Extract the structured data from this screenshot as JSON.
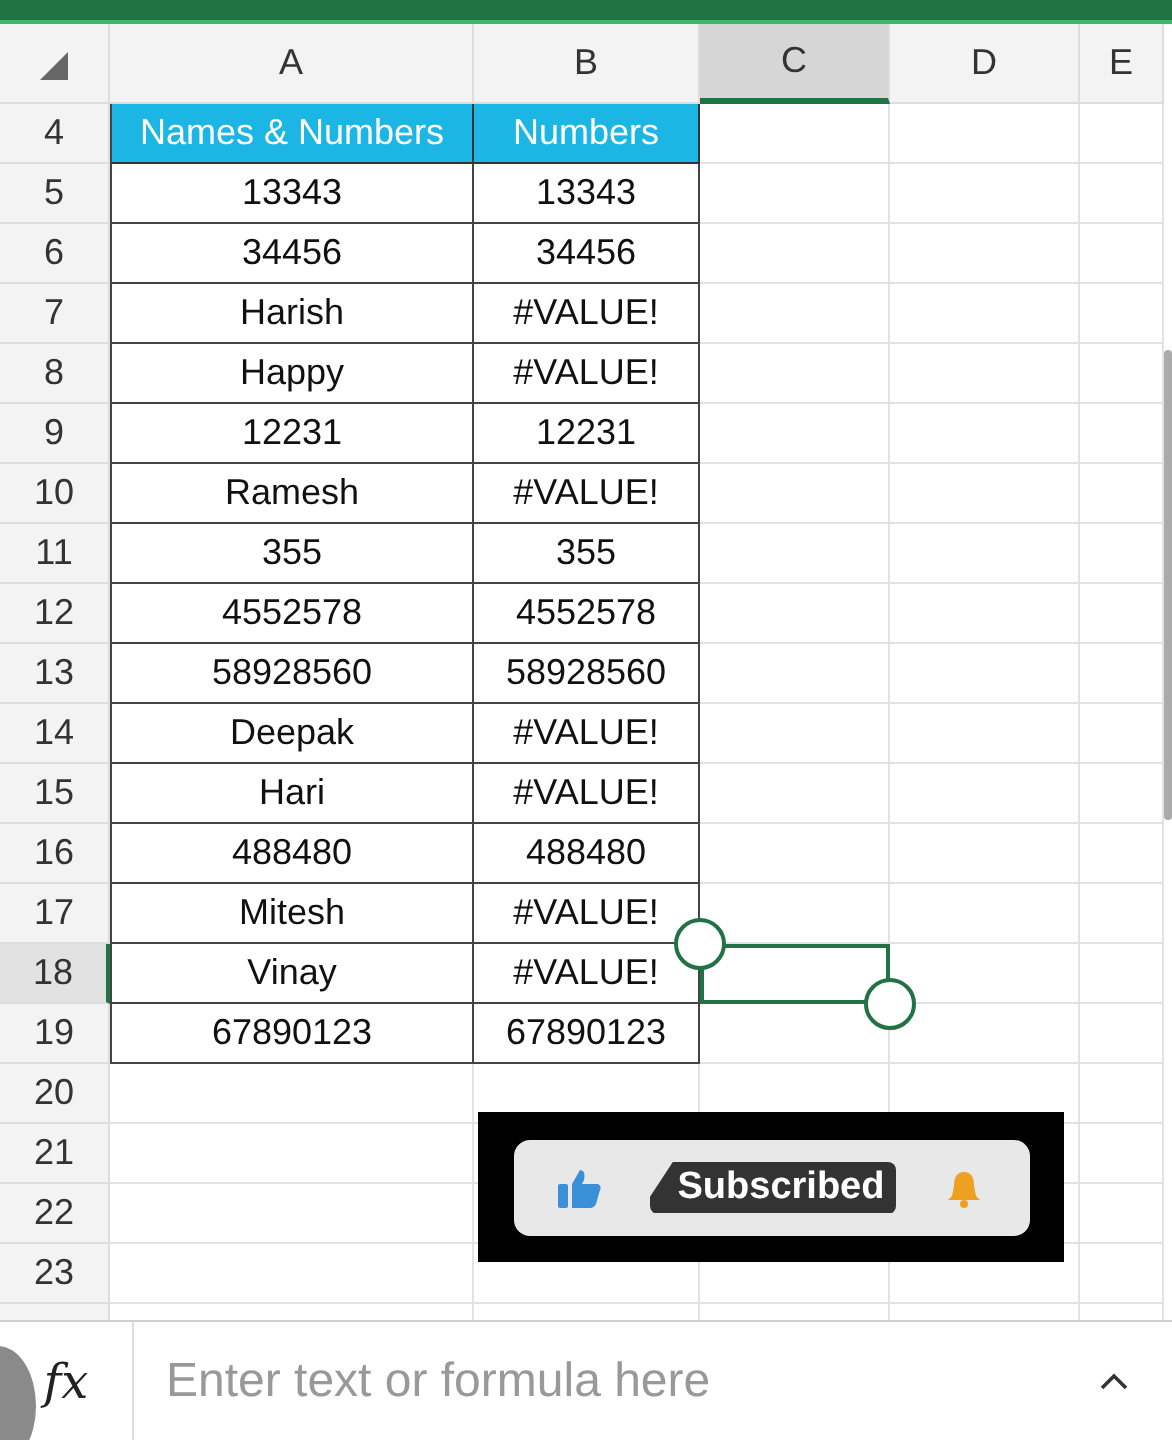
{
  "columns": [
    {
      "label": "A",
      "selected": false
    },
    {
      "label": "B",
      "selected": false
    },
    {
      "label": "C",
      "selected": true
    },
    {
      "label": "D",
      "selected": false
    },
    {
      "label": "E",
      "selected": false
    }
  ],
  "rows": [
    {
      "label": "4",
      "selected": false,
      "kind": "header",
      "cells": [
        "Names & Numbers",
        "Numbers"
      ]
    },
    {
      "label": "5",
      "selected": false,
      "kind": "data",
      "cells": [
        "13343",
        "13343"
      ]
    },
    {
      "label": "6",
      "selected": false,
      "kind": "data",
      "cells": [
        "34456",
        "34456"
      ]
    },
    {
      "label": "7",
      "selected": false,
      "kind": "data",
      "cells": [
        "Harish",
        "#VALUE!"
      ]
    },
    {
      "label": "8",
      "selected": false,
      "kind": "data",
      "cells": [
        "Happy",
        "#VALUE!"
      ]
    },
    {
      "label": "9",
      "selected": false,
      "kind": "data",
      "cells": [
        "12231",
        "12231"
      ]
    },
    {
      "label": "10",
      "selected": false,
      "kind": "data",
      "cells": [
        "Ramesh",
        "#VALUE!"
      ]
    },
    {
      "label": "11",
      "selected": false,
      "kind": "data",
      "cells": [
        "355",
        "355"
      ]
    },
    {
      "label": "12",
      "selected": false,
      "kind": "data",
      "cells": [
        "4552578",
        "4552578"
      ]
    },
    {
      "label": "13",
      "selected": false,
      "kind": "data",
      "cells": [
        "58928560",
        "58928560"
      ]
    },
    {
      "label": "14",
      "selected": false,
      "kind": "data",
      "cells": [
        "Deepak",
        "#VALUE!"
      ]
    },
    {
      "label": "15",
      "selected": false,
      "kind": "data",
      "cells": [
        "Hari",
        "#VALUE!"
      ]
    },
    {
      "label": "16",
      "selected": false,
      "kind": "data",
      "cells": [
        "488480",
        "488480"
      ]
    },
    {
      "label": "17",
      "selected": false,
      "kind": "data",
      "cells": [
        "Mitesh",
        "#VALUE!"
      ]
    },
    {
      "label": "18",
      "selected": true,
      "kind": "data",
      "cells": [
        "Vinay",
        "#VALUE!"
      ]
    },
    {
      "label": "19",
      "selected": false,
      "kind": "data",
      "cells": [
        "67890123",
        "67890123"
      ]
    },
    {
      "label": "20",
      "selected": false,
      "kind": "empty"
    },
    {
      "label": "21",
      "selected": false,
      "kind": "empty"
    },
    {
      "label": "22",
      "selected": false,
      "kind": "empty"
    },
    {
      "label": "23",
      "selected": false,
      "kind": "empty"
    }
  ],
  "subscribe_overlay": {
    "label": "Subscribed"
  },
  "formula_bar": {
    "fx": "fx",
    "placeholder": "Enter text or formula here"
  }
}
